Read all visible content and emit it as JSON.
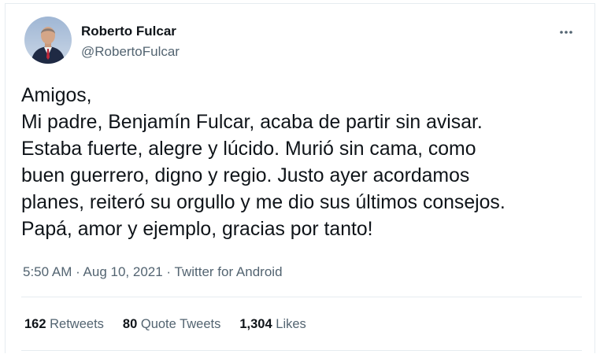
{
  "tweet": {
    "author": {
      "name": "Roberto Fulcar",
      "handle": "@RobertoFulcar"
    },
    "more_icon": "more-horizontal-icon",
    "text_lines": [
      "Amigos,",
      "Mi padre, Benjamín Fulcar, acaba de partir sin avisar.",
      "Estaba fuerte, alegre y lúcido. Murió sin cama, como",
      "buen guerrero, digno y regio. Justo ayer acordamos",
      "planes, reiteró su orgullo y me dio sus últimos consejos.",
      "Papá, amor y ejemplo, gracias por tanto!"
    ],
    "meta": {
      "time": "5:50 AM",
      "separator": " · ",
      "date": "Aug 10, 2021",
      "source": "Twitter for Android"
    },
    "stats": {
      "retweets": {
        "count": "162",
        "label": "Retweets"
      },
      "quote_tweets": {
        "count": "80",
        "label": "Quote Tweets"
      },
      "likes": {
        "count": "1,304",
        "label": "Likes"
      }
    },
    "colors": {
      "text": "#0f1419",
      "secondary": "#536471",
      "border": "#e6ecf0"
    }
  }
}
